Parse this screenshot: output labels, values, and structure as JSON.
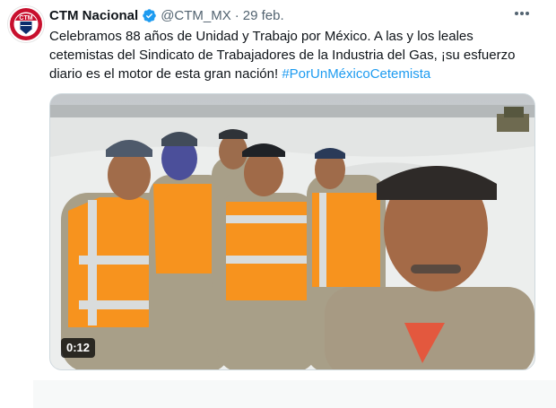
{
  "tweet": {
    "author_name": "CTM Nacional",
    "handle": "@CTM_MX",
    "separator": "·",
    "date": "29 feb.",
    "text": "Celebramos 88 años de Unidad y Trabajo por México. A las y los leales cetemistas del Sindicato de Trabajadores de la Industria del Gas, ¡su esfuerzo diario es el motor de esta gran nación! ",
    "hashtag": "#PorUnMéxicoCetemista",
    "avatar_text": "CTM",
    "video_duration": "0:12"
  },
  "colors": {
    "accent": "#1d9bf0",
    "verified": "#1d9bf0",
    "text": "#0f1419",
    "secondary": "#536471",
    "vest": "#f7931e",
    "reflective": "#d9dcdc"
  },
  "icons": [
    "verified-badge-icon",
    "more-options-icon",
    "ctm-logo"
  ]
}
